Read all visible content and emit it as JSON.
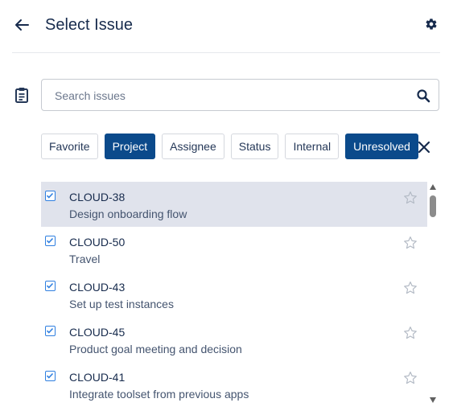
{
  "header": {
    "title": "Select Issue",
    "back_icon": "arrow-left-icon",
    "settings_icon": "gear-icon"
  },
  "search": {
    "placeholder": "Search issues",
    "value": "",
    "icon": "search-icon"
  },
  "filters": [
    {
      "label": "Favorite",
      "active": false
    },
    {
      "label": "Project",
      "active": true
    },
    {
      "label": "Assignee",
      "active": false
    },
    {
      "label": "Status",
      "active": false
    },
    {
      "label": "Internal",
      "active": false
    },
    {
      "label": "Unresolved",
      "active": true
    }
  ],
  "issues": [
    {
      "key": "CLOUD-38",
      "summary": "Design onboarding flow",
      "checked": true,
      "selected": true
    },
    {
      "key": "CLOUD-50",
      "summary": "Travel",
      "checked": true,
      "selected": false
    },
    {
      "key": "CLOUD-43",
      "summary": "Set up test instances",
      "checked": true,
      "selected": false
    },
    {
      "key": "CLOUD-45",
      "summary": "Product goal meeting and decision",
      "checked": true,
      "selected": false
    },
    {
      "key": "CLOUD-41",
      "summary": "Integrate toolset from previous apps",
      "checked": true,
      "selected": false
    }
  ],
  "colors": {
    "accent": "#0b4a8b",
    "checkbox": "#2f7fe0",
    "selected_row": "#e0e3ec",
    "text": "#172b4d"
  }
}
